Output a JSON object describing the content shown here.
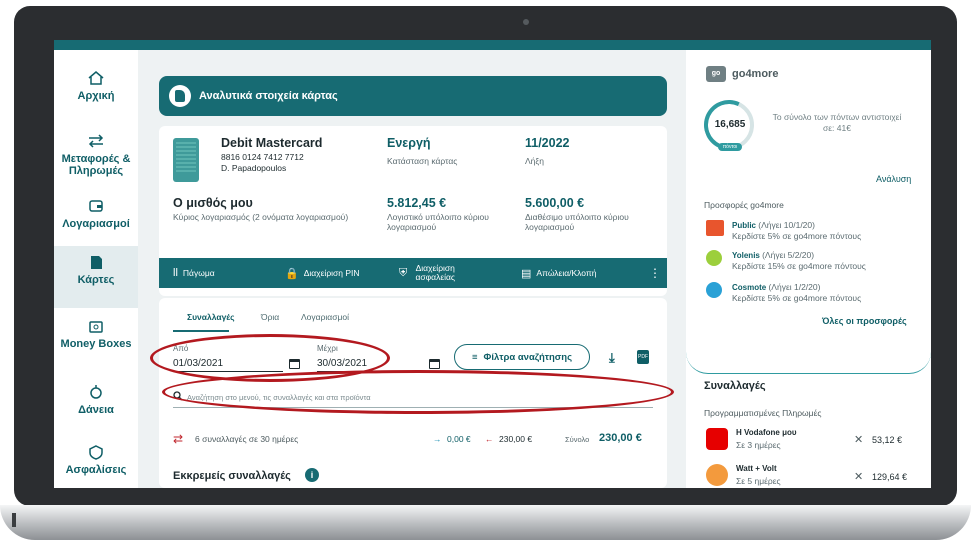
{
  "nav": {
    "items": [
      {
        "label": "Αρχική",
        "icon": "home-icon"
      },
      {
        "label": "Μεταφορές & Πληρωμές",
        "icon": "transfer-icon"
      },
      {
        "label": "Λογαριασμοί",
        "icon": "wallet-icon"
      },
      {
        "label": "Κάρτες",
        "icon": "card-icon"
      },
      {
        "label": "Money Boxes",
        "icon": "moneybox-icon"
      },
      {
        "label": "Δάνεια",
        "icon": "loan-icon"
      },
      {
        "label": "Ασφαλίσεις",
        "icon": "insurance-icon"
      }
    ],
    "active": "Κάρτες"
  },
  "card_header": {
    "title": "Αναλυτικά στοιχεία κάρτας"
  },
  "card": {
    "name": "Debit Mastercard",
    "number": "8816 0124 7412 7712",
    "holder": "D. Papadopoulos",
    "status_value": "Ενεργή",
    "status_label": "Κατάσταση κάρτας",
    "expiry_value": "11/2022",
    "expiry_label": "Λήξη"
  },
  "account": {
    "name": "Ο μισθός μου",
    "desc": "Κύριος λογαριασμός (2 ονόματα λογαριασμού)",
    "ledger_value": "5.812,45 €",
    "ledger_label": "Λογιστικό υπόλοιπο κύριου λογαριασμού",
    "available_value": "5.600,00 €",
    "available_label": "Διαθέσιμο υπόλοιπο κύριου λογαριασμού"
  },
  "actions": {
    "freeze": "Πάγωμα",
    "pin": "Διαχείριση PIN",
    "security": "Διαχείριση ασφαλείας",
    "lost": "Απώλεια/Κλοπή"
  },
  "tabs": [
    "Συναλλαγές",
    "Όρια",
    "Λογαριασμοί"
  ],
  "filters": {
    "from_label": "Από",
    "from_value": "01/03/2021",
    "to_label": "Μέχρι",
    "to_value": "30/03/2021",
    "filter_button": "Φίλτρα αναζήτησης",
    "search_placeholder": "Αναζήτηση στο μενού, τις συναλλαγές και στα προϊόντα"
  },
  "summary": {
    "count_text": "6 συναλλαγές σε 30 ημέρες",
    "incoming": "0,00 €",
    "outgoing": "230,00 €",
    "total_label": "Σύνολο",
    "total_value": "230,00 €"
  },
  "pending": {
    "title": "Εκκρεμείς συναλλαγές"
  },
  "go4more": {
    "logo_text": "go",
    "title": "go4more",
    "points": "16,685",
    "points_badge": "πόντοι",
    "equiv_text": "Το σύνολο των πόντων αντιστοιχεί σε: 41€",
    "analysis_link": "Ανάλυση",
    "offers_title": "Προσφορές go4more",
    "offers": [
      {
        "brand": "Public",
        "date": "(Λήγει 10/1/20)",
        "desc": "Κερδίστε 5% σε go4more πόντους",
        "color": "#e8552d"
      },
      {
        "brand": "Yolenis",
        "date": "(Λήγει 5/2/20)",
        "desc": "Κερδίστε 15% σε go4more πόντους",
        "color": "#9ccf3c"
      },
      {
        "brand": "Cosmote",
        "date": "(Λήγει 1/2/20)",
        "desc": "Κερδίστε 5% σε go4more πόντους",
        "color": "#2aa1d6"
      }
    ],
    "all_offers": "Όλες οι προσφορές"
  },
  "transactions_panel": {
    "title": "Συναλλαγές",
    "subtitle": "Προγραμματισμένες Πληρωμές",
    "items": [
      {
        "name": "Η Vodafone μου",
        "when": "Σε 3 ημέρες",
        "amount": "53,12 €",
        "color": "#e60000"
      },
      {
        "name": "Watt + Volt",
        "when": "Σε 5 ημέρες",
        "amount": "129,64 €",
        "color": "#f39a3d"
      }
    ]
  }
}
